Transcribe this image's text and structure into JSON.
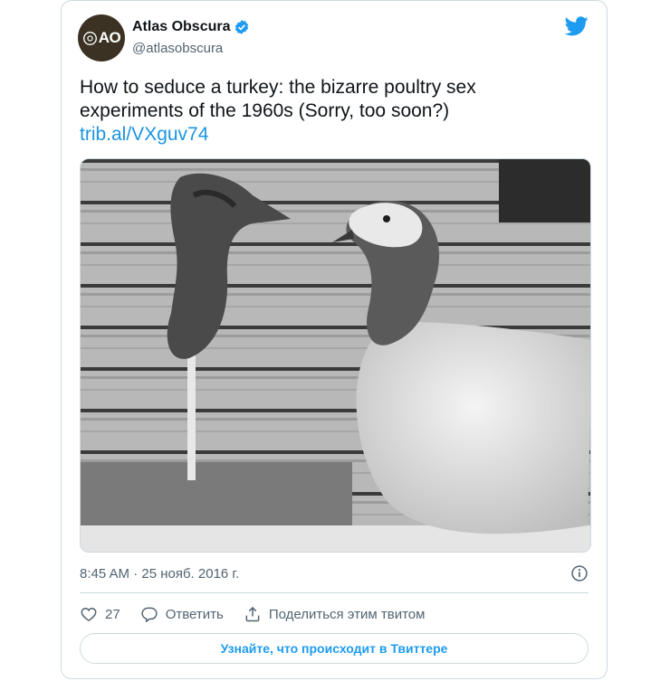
{
  "author": {
    "avatar_text": "AO",
    "name": "Atlas Obscura",
    "handle": "@atlasobscura",
    "verified": true
  },
  "tweet": {
    "text": "How to seduce a turkey: the bizarre poultry sex experiments of the 1960s (Sorry, too soon?)",
    "link": "trib.al/VXguv74"
  },
  "meta": {
    "timestamp": "8:45 AM · 25 нояб. 2016 г."
  },
  "actions": {
    "like_count": "27",
    "reply_label": "Ответить",
    "share_label": "Поделиться этим твитом"
  },
  "cta": {
    "label": "Узнайте, что происходит в Твиттере"
  },
  "colors": {
    "link": "#1b95e0",
    "twitter_blue": "#1d9bf0",
    "border": "#cfd9de",
    "secondary_text": "#536471",
    "avatar_bg": "#3b3223"
  },
  "icons": [
    "twitter-bird-icon",
    "verified-badge-icon",
    "info-icon",
    "heart-icon",
    "reply-icon",
    "share-icon"
  ]
}
